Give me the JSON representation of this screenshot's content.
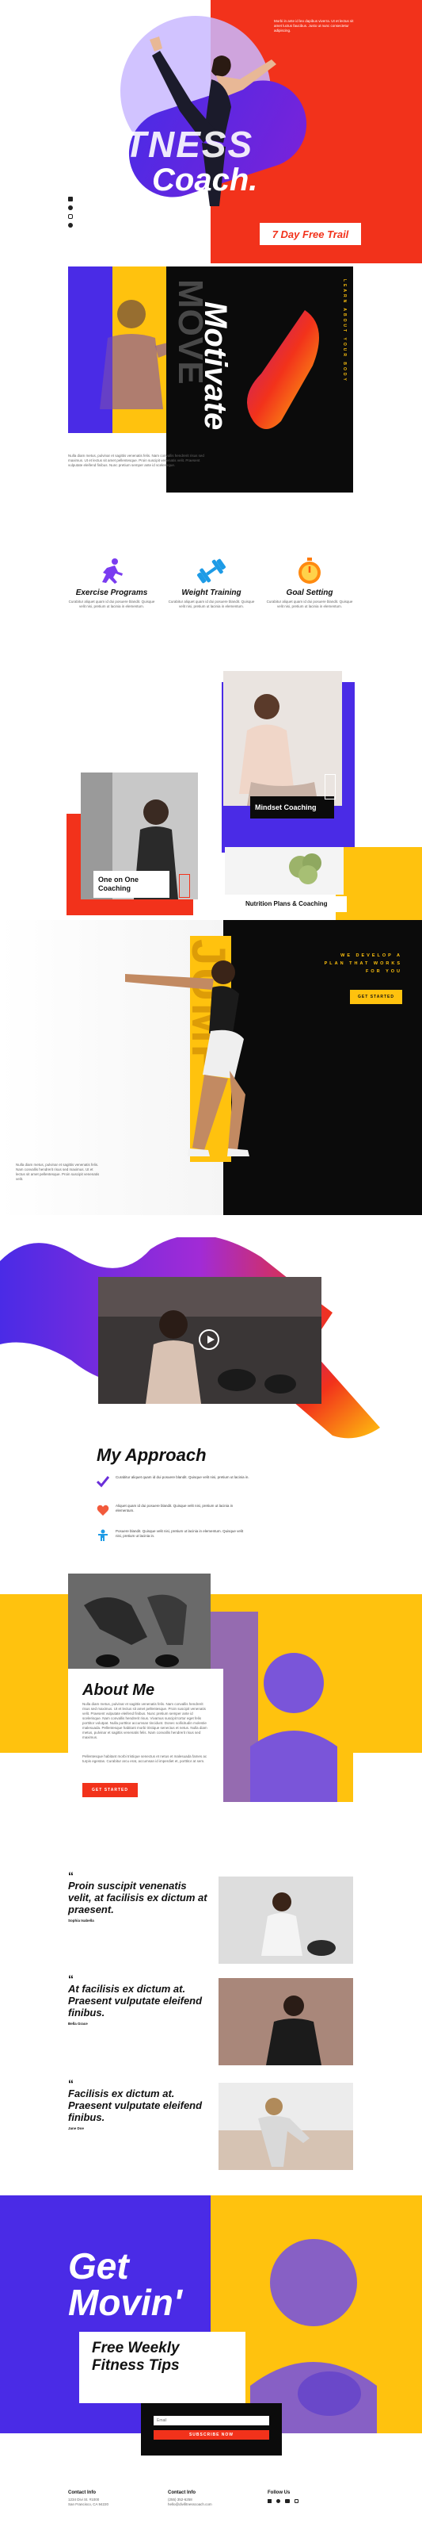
{
  "colors": {
    "red": "#f2321b",
    "purple": "#4a2be6",
    "yellow": "#ffc20e",
    "black": "#0b0b0b",
    "grey": "#f2f2f2"
  },
  "hero": {
    "title_line1": "FITNESS",
    "title_line2": "Coach.",
    "intro": "Morbi in ante id leo dapibus viverra. Ut et lectus sit amet luctus faucibus. Justo ut nunc consectetur adipiscing.",
    "cta": "7 Day Free Trail",
    "social": [
      "facebook-icon",
      "twitter-icon",
      "instagram-icon",
      "pinterest-icon"
    ]
  },
  "motivate": {
    "word_move": "MOVE",
    "word_motivate": "Motivate",
    "side_caption": "LEARN ABOUT YOUR BODY",
    "paragraph": "Nulla diam metus, pulvinar et sagittis venenatis felis. Nam convallis hendrerit risus sed maximus. Ut et lectus sit amet pellentesque. Proin suscipit venenatis velit. Praesent vulputate eleifend finibus. Nunc pretium semper ante id scelerisque."
  },
  "services": [
    {
      "icon": "running-person-icon",
      "title": "Exercise Programs",
      "text": "Curabitur aliquet quam id dui posuere blandit. Quisque velit nisi, pretium ut lacinia in elementum."
    },
    {
      "icon": "dumbbell-icon",
      "title": "Weight Training",
      "text": "Curabitur aliquet quam id dui posuere blandit. Quisque velit nisi, pretium ut lacinia in elementum."
    },
    {
      "icon": "stopwatch-icon",
      "title": "Goal Setting",
      "text": "Curabitur aliquet quam id dui posuere blandit. Quisque velit nisi, pretium ut lacinia in elementum."
    }
  ],
  "cards": {
    "mindset": "Mindset Coaching",
    "one_on_one_line1": "One on One",
    "one_on_one_line2": "Coaching",
    "nutrition": "Nutrition Plans & Coaching"
  },
  "plan": {
    "text_line1": "WE DEVELOP A",
    "text_line2": "PLAN THAT WORKS",
    "text_line3": "FOR YOU",
    "button": "GET STARTED",
    "big_word": "JUMP",
    "paragraph": "Nulla diam metus, pulvinar et sagittis venenatis felis. Nam convallis hendrerit risus sed maximus. Ut et lectus sit amet pellentesque. Proin suscipit venenatis velit."
  },
  "approach": {
    "title": "My Approach",
    "items": [
      {
        "icon": "checkmark-icon",
        "text": "Curabitur aliquet quam id dui posuere blandit. Quisque velit nisi, pretium ut lacinia in."
      },
      {
        "icon": "heart-icon",
        "text": "Aliquet quam id dui posuere blandit. Quisque velit nisi, pretium ut lacinia in elementum."
      },
      {
        "icon": "person-icon",
        "text": "Posuere blandit. Quisque velit nisi, pretium ut lacinia in elementum. Quisque velit nisi, pretium ut lacinia in."
      }
    ]
  },
  "about": {
    "title": "About Me",
    "paragraph1": "Nulla diam metus, pulvinar et sagittis venenatis felis. Nam convallis hendrerit risus sed maximus. Ut et lectus sit amet pellentesque. Proin suscipit venenatis velit. Praesent vulputate eleifend finibus. Nunc pretium semper ante id scelerisque. Nam convallis hendrerit risus. Vivamus suscipit tortor eget felis porttitor volutpat. Nulla porttitor accumsan tincidunt. Donec sollicitudin molestie malesuada. Pellentesque habitant morbi tristique senectus et netus. Nulla diam metus, pulvinar et sagittis venenatis felis. Nam convallis hendrerit risus sed maximus.",
    "paragraph2": "Pellentesque habitant morbi tristique senectus et netus et malesuada fames ac turpis egestas. Curabitur arcu erat, accumsan id imperdiet et, porttitor at sem.",
    "button": "GET STARTED"
  },
  "testimonials": [
    {
      "quote": "Proin suscipit venenatis velit, at facilisis ex dictum at praesent.",
      "name": "Sophia Isabella"
    },
    {
      "quote": "At facilisis ex dictum at. Praesent vulputate eleifend finibus.",
      "name": "Bella Grace"
    },
    {
      "quote": "Facilisis ex dictum at. Praesent vulputate eleifend finibus.",
      "name": "Jane Doe"
    }
  ],
  "cta_section": {
    "line1": "Get",
    "line2": "Movin'",
    "sub_line1": "Free Weekly",
    "sub_line2": "Fitness Tips",
    "email_placeholder": "Email",
    "subscribe": "SUBSCRIBE NOW"
  },
  "footer": {
    "contact_title": "Contact Info",
    "address_line1": "1234 Divi St. #1000",
    "address_line2": "San Francisco, CA 94220",
    "contact_title2": "Contact Info",
    "phone": "(255) 352-6258",
    "email": "hello@divifitnesscoach.com",
    "follow_title": "Follow Us"
  }
}
